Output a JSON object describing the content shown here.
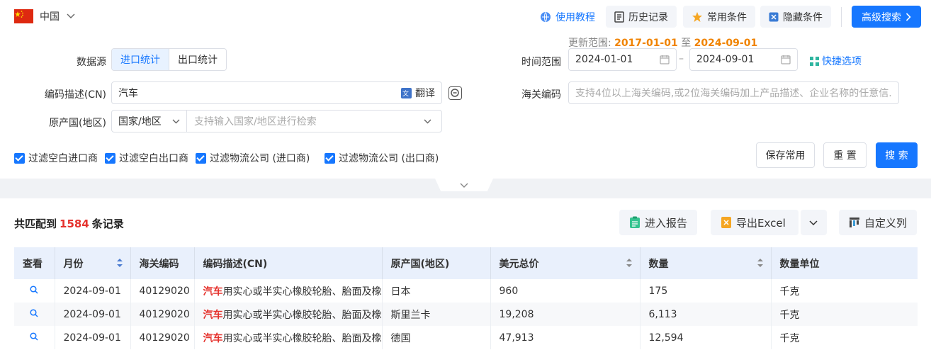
{
  "top": {
    "country": "中国",
    "tutorial": "使用教程",
    "history": "历史记录",
    "common": "常用条件",
    "hidden": "隐藏条件",
    "advanced": "高级搜索"
  },
  "range_note": {
    "prefix": "更新范围:",
    "start": "2017-01-01",
    "mid": "至",
    "end": "2024-09-01"
  },
  "form": {
    "datasource_label": "数据源",
    "import_label": "进口统计",
    "export_label": "出口统计",
    "time_label": "时间范围",
    "date_start": "2024-01-01",
    "date_sep": "–",
    "date_end": "2024-09-01",
    "quick_label": "快捷选项",
    "desc_label": "编码描述(CN)",
    "desc_value": "汽车",
    "translate_label": "翻译",
    "hs_label": "海关编码",
    "hs_placeholder": "支持4位以上海关编码,或2位海关编码加上产品描述、企业名称的任意信...",
    "origin_label": "原产国(地区)",
    "origin_type": "国家/地区",
    "origin_placeholder": "支持输入国家/地区进行检索"
  },
  "filters": [
    "过滤空白进口商",
    "过滤空白出口商",
    "过滤物流公司 (进口商)",
    "过滤物流公司 (出口商)"
  ],
  "buttons": {
    "save": "保存常用",
    "reset": "重 置",
    "search": "搜 索"
  },
  "result": {
    "prefix": "共匹配到",
    "count": "1584",
    "suffix": "条记录",
    "report": "进入报告",
    "export": "导出Excel",
    "custom": "自定义列"
  },
  "table": {
    "headers": [
      "查看",
      "月份",
      "海关编码",
      "编码描述(CN)",
      "原产国(地区)",
      "美元总价",
      "数量",
      "数量单位"
    ],
    "rows": [
      {
        "month": "2024-09-01",
        "hs": "40129020",
        "desc_hl": "汽车",
        "desc_rest": "用实心或半实心橡胶轮胎、胎面及橡",
        "origin": "日本",
        "usd": "960",
        "qty": "175",
        "unit": "千克"
      },
      {
        "month": "2024-09-01",
        "hs": "40129020",
        "desc_hl": "汽车",
        "desc_rest": "用实心或半实心橡胶轮胎、胎面及橡",
        "origin": "斯里兰卡",
        "usd": "19,208",
        "qty": "6,113",
        "unit": "千克"
      },
      {
        "month": "2024-09-01",
        "hs": "40129020",
        "desc_hl": "汽车",
        "desc_rest": "用实心或半实心橡胶轮胎、胎面及橡",
        "origin": "德国",
        "usd": "47,913",
        "qty": "12,594",
        "unit": "千克"
      }
    ]
  },
  "colors": {
    "primary": "#1677ff",
    "highlight": "#e5322d",
    "range": "#f08300"
  }
}
